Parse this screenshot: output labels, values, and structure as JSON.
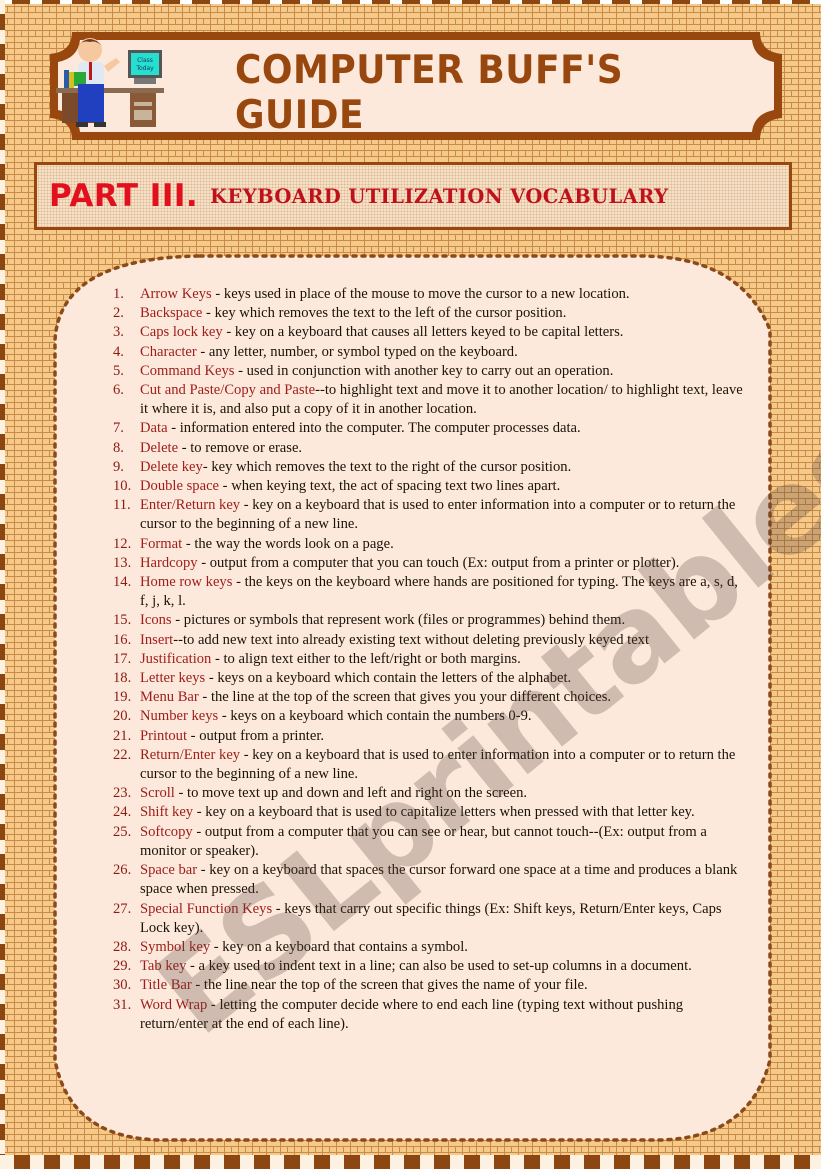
{
  "header": {
    "title": "Computer Buff's Guide",
    "mascot_sign": [
      "Class",
      "Today"
    ]
  },
  "section": {
    "part_label": "PART III.",
    "subtitle": "KEYBOARD UTILIZATION VOCABULARY"
  },
  "watermark": "ESLprintables.com",
  "colors": {
    "brand_brown": "#98480f",
    "part_red": "#e1101c",
    "term_red": "#9e1c1a",
    "panel_bg": "#fde9dc",
    "brick_bg": "#f5c98a"
  },
  "vocabulary": [
    {
      "num": "1.",
      "term": "Arrow Keys",
      "definition": " - keys used in place of the mouse to move the cursor to a new location."
    },
    {
      "num": "2.",
      "term": "Backspace",
      "definition": " - key which removes the text to the left of the cursor position."
    },
    {
      "num": "3.",
      "term": "Caps lock key",
      "definition": " - key on a keyboard that causes all letters keyed to be capital letters."
    },
    {
      "num": "4.",
      "term": "Character",
      "definition": " - any letter, number, or symbol typed on the keyboard."
    },
    {
      "num": "5.",
      "term": "Command Keys",
      "definition": " - used in conjunction with another key to carry out an operation."
    },
    {
      "num": "6.",
      "term": "Cut and Paste/Copy and Paste",
      "definition": "--to highlight text and move it to another location/ to highlight text, leave it where it is, and also put a copy of it in another location."
    },
    {
      "num": "7.",
      "term": "Data",
      "definition": " - information entered into the computer.  The computer processes data."
    },
    {
      "num": "8.",
      "term": "Delete",
      "definition": "  - to remove or erase."
    },
    {
      "num": "9.",
      "term": "Delete key",
      "definition": "- key which removes the text to the right of the cursor position."
    },
    {
      "num": "10.",
      "term": "Double space",
      "definition": " - when keying text, the act of spacing text two lines apart."
    },
    {
      "num": "11.",
      "term": "Enter/Return key",
      "definition": " - key on a keyboard that is used to enter information into a computer or to return the cursor to the beginning of a new line."
    },
    {
      "num": "12.",
      "term": "Format",
      "definition": " - the way the words look on a page."
    },
    {
      "num": "13.",
      "term": "Hardcopy",
      "definition": " - output from a computer that you can touch (Ex: output from a printer or plotter)."
    },
    {
      "num": "14.",
      "term": "Home row keys",
      "definition": " - the keys on the keyboard where hands are positioned for typing. The keys are a, s, d, f, j, k, l."
    },
    {
      "num": "15.",
      "term": "Icons",
      "definition": " - pictures or symbols that represent work (files or programmes) behind them."
    },
    {
      "num": "16.",
      "term": "Insert",
      "definition": "--to add new text into already existing text without deleting previously keyed text"
    },
    {
      "num": "17.",
      "term": "Justification",
      "definition": " - to align text either to the left/right or both margins."
    },
    {
      "num": "18.",
      "term": "Letter keys",
      "definition": " - keys on a keyboard which contain the letters of the alphabet."
    },
    {
      "num": "19.",
      "term": "Menu Bar",
      "definition": " - the line at the top of the screen that gives you your different choices."
    },
    {
      "num": "20.",
      "term": "Number keys",
      "definition": " - keys on a keyboard which contain the numbers 0-9."
    },
    {
      "num": "21.",
      "term": "Printout",
      "definition": " - output from a printer."
    },
    {
      "num": "22.",
      "term": "Return/Enter key",
      "definition": " - key on a keyboard that is used to enter information into a computer or to return the cursor to the beginning of a new line."
    },
    {
      "num": "23.",
      "term": "Scroll",
      "definition": " - to move text up and down and left and right on the screen."
    },
    {
      "num": "24.",
      "term": "Shift key",
      "definition": " - key on a keyboard that is used to capitalize letters when pressed with that letter key."
    },
    {
      "num": "25.",
      "term": "Softcopy",
      "definition": " - output from a computer that you can see or hear, but cannot touch--(Ex: output from a monitor or speaker)."
    },
    {
      "num": "26.",
      "term": "Space bar",
      "definition": " - key on a keyboard that spaces the cursor forward one space at a time and produces a blank space when pressed."
    },
    {
      "num": "27.",
      "term": "Special Function Keys",
      "definition": " - keys that carry out specific things (Ex: Shift keys, Return/Enter keys, Caps Lock key)."
    },
    {
      "num": "28.",
      "term": "Symbol key",
      "definition": " - key on a keyboard that contains a symbol."
    },
    {
      "num": "29.",
      "term": "Tab key",
      "definition": " - a key used to indent text in a line; can also be used to set-up columns in a document."
    },
    {
      "num": "30.",
      "term": "Title Bar",
      "definition": " - the line near the top of the screen that gives the name of your file."
    },
    {
      "num": "31.",
      "term": "Word Wrap",
      "definition": " - letting the computer decide where to end each line (typing text without pushing return/enter at the end of each line)."
    }
  ]
}
